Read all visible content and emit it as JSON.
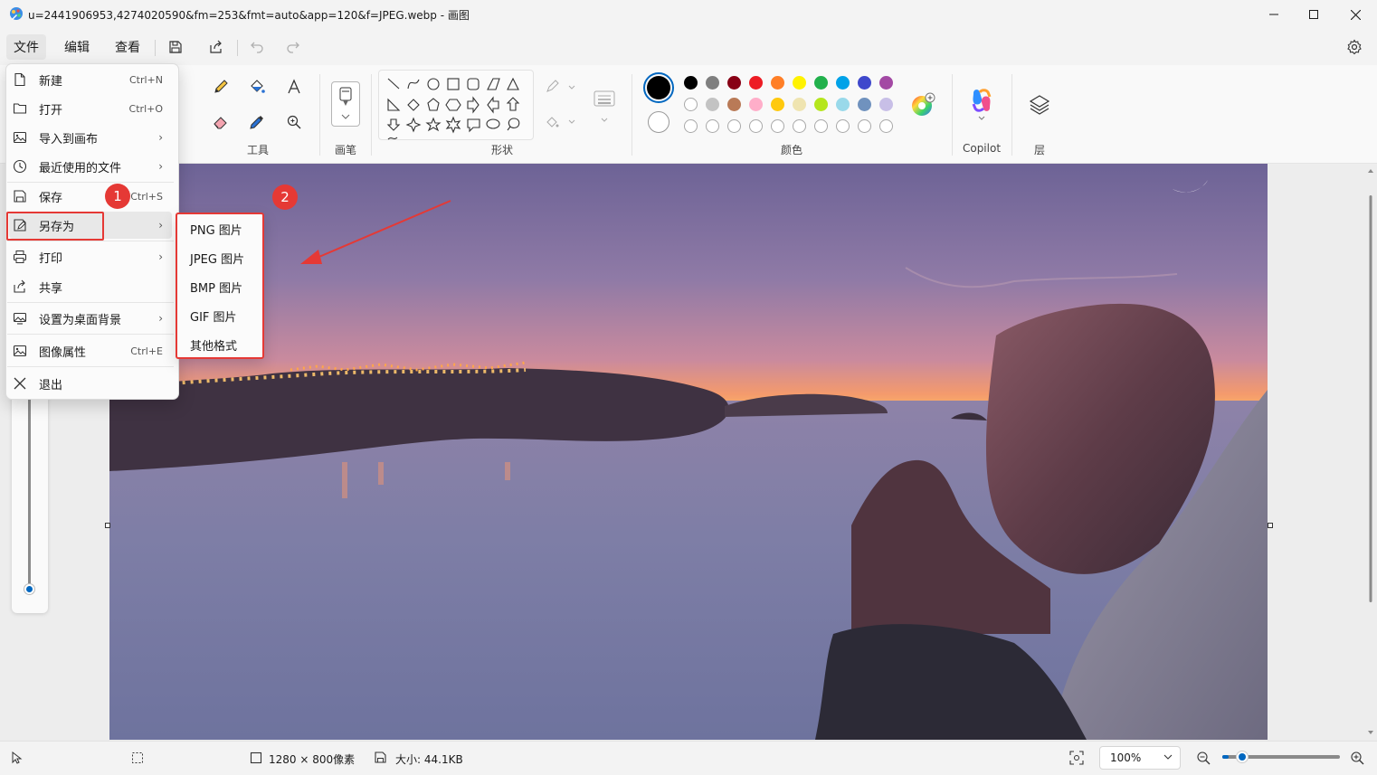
{
  "window": {
    "title": "u=2441906953,4274020590&fm=253&fmt=auto&app=120&f=JPEG.webp - 画图"
  },
  "menubar": {
    "file": "文件",
    "edit": "编辑",
    "view": "查看"
  },
  "ribbon": {
    "groups": {
      "tools": "工具",
      "brushes": "画笔",
      "shapes": "形状",
      "colors": "颜色",
      "copilot": "Copilot",
      "layers": "层"
    },
    "palette_row1": [
      "#000000",
      "#7f7f7f",
      "#880015",
      "#ed1c24",
      "#ff7f27",
      "#fff200",
      "#22b14c",
      "#00a2e8",
      "#3f48cc",
      "#a349a4"
    ],
    "palette_row2": [
      "#ffffff",
      "#c3c3c3",
      "#b97a57",
      "#ffaec9",
      "#ffc90e",
      "#efe4b0",
      "#b5e61d",
      "#99d9ea",
      "#7092be",
      "#c8bfe7"
    ]
  },
  "file_menu": {
    "items": [
      {
        "label": "新建",
        "shortcut": "Ctrl+N"
      },
      {
        "label": "打开",
        "shortcut": "Ctrl+O"
      },
      {
        "label": "导入到画布",
        "shortcut": ""
      },
      {
        "label": "最近使用的文件",
        "shortcut": ""
      },
      {
        "label": "保存",
        "shortcut": "Ctrl+S"
      },
      {
        "label": "另存为",
        "shortcut": ""
      },
      {
        "label": "打印",
        "shortcut": ""
      },
      {
        "label": "共享",
        "shortcut": ""
      },
      {
        "label": "设置为桌面背景",
        "shortcut": ""
      },
      {
        "label": "图像属性",
        "shortcut": "Ctrl+E"
      },
      {
        "label": "退出",
        "shortcut": ""
      }
    ]
  },
  "save_as_submenu": {
    "items": [
      "PNG 图片",
      "JPEG 图片",
      "BMP 图片",
      "GIF 图片",
      "其他格式"
    ]
  },
  "annotations": {
    "badge1": "1",
    "badge2": "2"
  },
  "statusbar": {
    "dimensions": "1280 × 800像素",
    "size": "大小: 44.1KB",
    "zoom": "100%",
    "zoom_level_fraction": 0.05
  },
  "colors": {
    "accent": "#0067c0",
    "annotation": "#e53935"
  }
}
